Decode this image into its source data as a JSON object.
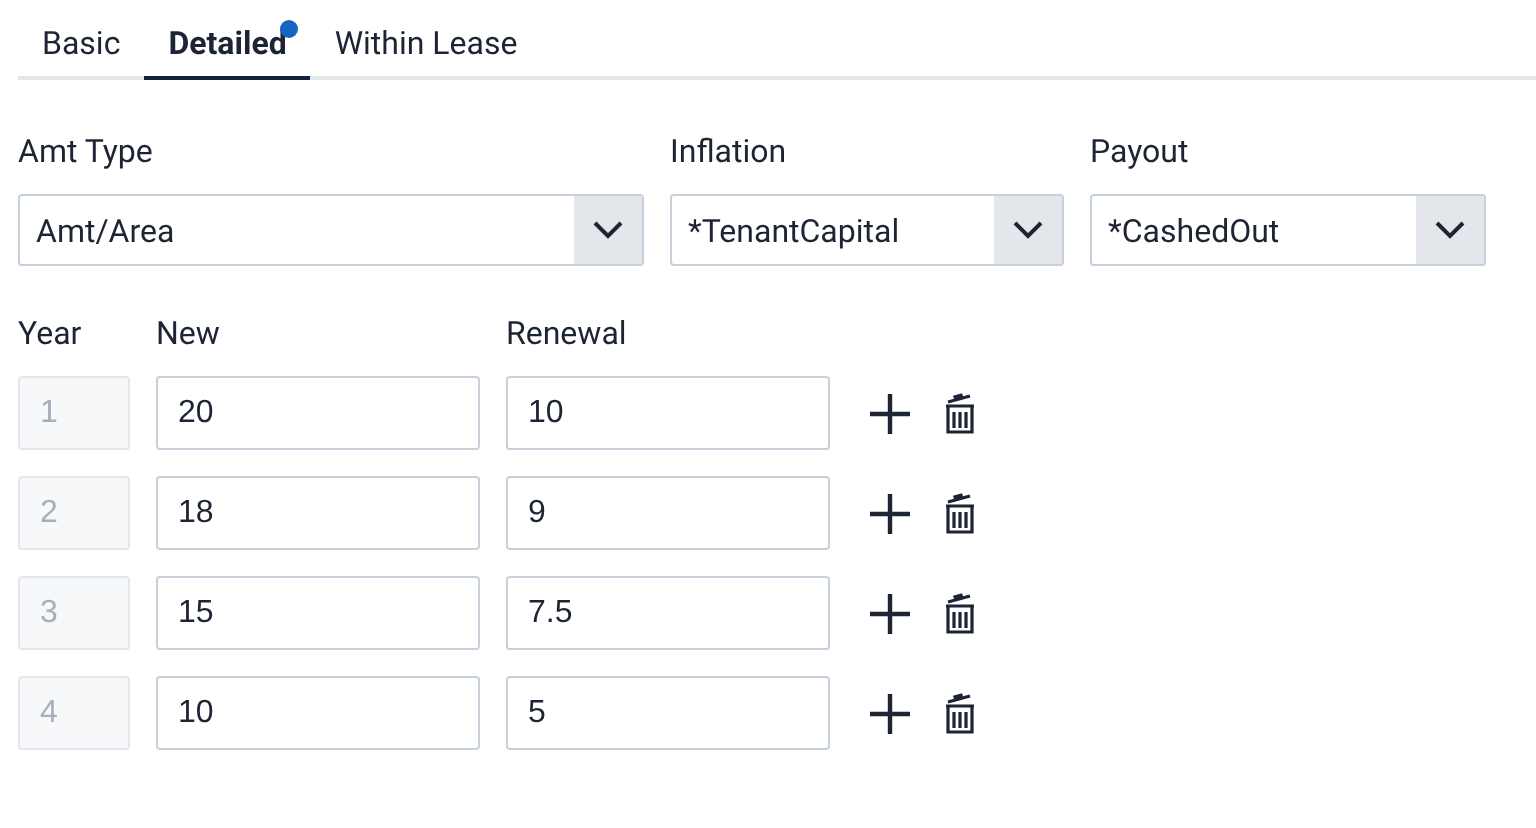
{
  "tabs": [
    {
      "label": "Basic",
      "selected": false,
      "indicator": false
    },
    {
      "label": "Detailed",
      "selected": true,
      "indicator": true
    },
    {
      "label": "Within Lease",
      "selected": false,
      "indicator": false
    }
  ],
  "selects": [
    {
      "label": "Amt Type",
      "value": "Amt/Area"
    },
    {
      "label": "Inflation",
      "value": "*TenantCapital"
    },
    {
      "label": "Payout",
      "value": "*CashedOut"
    }
  ],
  "table": {
    "columns": [
      "Year",
      "New",
      "Renewal"
    ],
    "rows": [
      {
        "year": "1",
        "year_disabled": true,
        "new": "20",
        "renewal": "10"
      },
      {
        "year": "2",
        "year_disabled": true,
        "new": "18",
        "renewal": "9"
      },
      {
        "year": "3",
        "year_disabled": true,
        "new": "15",
        "renewal": "7.5"
      },
      {
        "year": "4",
        "year_disabled": true,
        "new": "10",
        "renewal": "5"
      }
    ]
  }
}
